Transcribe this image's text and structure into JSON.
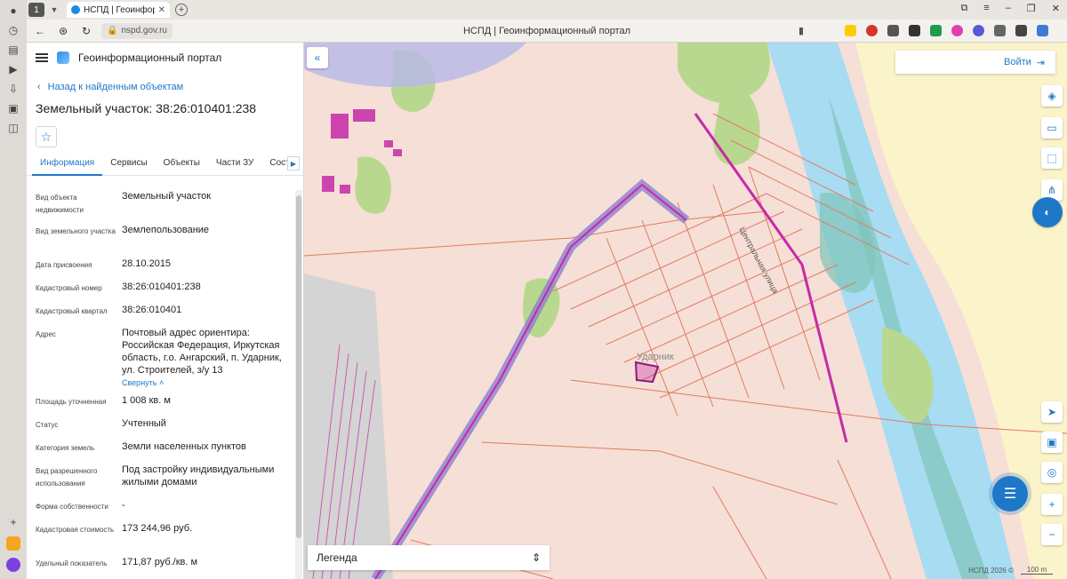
{
  "browser": {
    "tab_count": "1",
    "tab_title": "НСПД | Геоинформаци",
    "url": "nspd.gov.ru",
    "page_title": "НСПД | Геоинформационный портал"
  },
  "panel": {
    "portal_name": "Геоинформационный портал",
    "back_link": "Назад к найденным объектам",
    "object_title": "Земельный участок: 38:26:010401:238",
    "tabs": [
      "Информация",
      "Сервисы",
      "Объекты",
      "Части ЗУ",
      "Состав"
    ],
    "properties": [
      {
        "label": "Вид объекта недвижимости",
        "value": "Земельный участок"
      },
      {
        "label": "Вид земельного участка",
        "value": "Землепользование"
      },
      {
        "label": "Дата присвоения",
        "value": "28.10.2015"
      },
      {
        "label": "Кадастровый номер",
        "value": "38:26:010401:238"
      },
      {
        "label": "Кадастровый квартал",
        "value": "38:26:010401"
      },
      {
        "label": "Адрес",
        "value": "Почтовый адрес ориентира: Российская Федерация, Иркутская область, г.о. Ангарский, п. Ударник, ул. Строителей, з/у 13"
      },
      {
        "label": "Площадь уточненная",
        "value": "1 008 кв. м"
      },
      {
        "label": "Статус",
        "value": "Учтенный"
      },
      {
        "label": "Категория земель",
        "value": "Земли населенных пунктов"
      },
      {
        "label": "Вид разрешенного использования",
        "value": "Под застройку индивидуальными жилыми домами"
      },
      {
        "label": "Форма собственности",
        "value": "-"
      },
      {
        "label": "Кадастровая стоимость",
        "value": "173 244,96 руб."
      },
      {
        "label": "Удельный показатель",
        "value": "171,87 руб./кв. м"
      }
    ],
    "collapse_label": "Свернуть"
  },
  "map": {
    "login_label": "Войти",
    "legend_label": "Легенда",
    "place_label": "Ударник",
    "street_label": "Центральная улица",
    "copyright": "НСПД 2026 ©",
    "scale": "100 m",
    "colors": {
      "land": "#f6dfd6",
      "river": "#a8dcf2",
      "forest": "#b9d88f",
      "parcel_line": "#e07b62",
      "highlight": "#c52aa8",
      "road_band": "#8d7fd0"
    }
  }
}
